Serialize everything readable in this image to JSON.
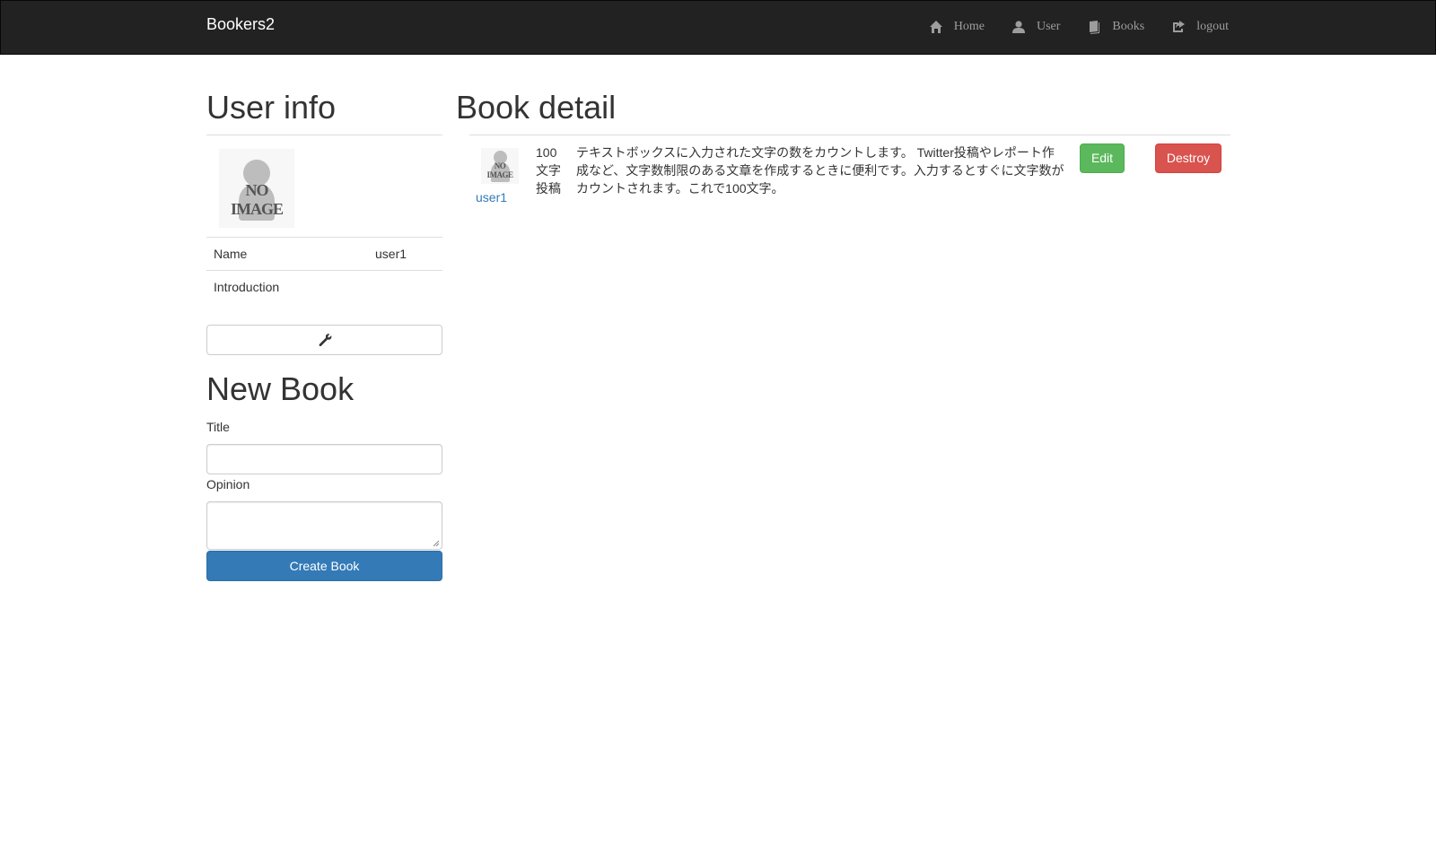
{
  "navbar": {
    "brand": "Bookers2",
    "items": [
      {
        "label": "Home",
        "icon": "home-icon"
      },
      {
        "label": "User",
        "icon": "user-icon"
      },
      {
        "label": "Books",
        "icon": "book-icon"
      },
      {
        "label": "logout",
        "icon": "logout-icon"
      }
    ]
  },
  "user_info": {
    "heading": "User info",
    "avatar_text": "NO IMAGE",
    "rows": [
      {
        "key": "Name",
        "value": "user1"
      },
      {
        "key": "Introduction",
        "value": ""
      }
    ],
    "edit_icon": "wrench-icon"
  },
  "new_book": {
    "heading": "New Book",
    "title_label": "Title",
    "title_value": "",
    "opinion_label": "Opinion",
    "opinion_value": "",
    "submit_label": "Create Book"
  },
  "book_detail": {
    "heading": "Book detail",
    "avatar_text": "NO IMAGE",
    "user_name": "user1",
    "title": "100文字投稿",
    "body": "テキストボックスに入力された文字の数をカウントします。 Twitter投稿やレポート作成など、文字数制限のある文章を作成するときに便利です。入力するとすぐに文字数がカウントされます。これで100文字。",
    "edit_label": "Edit",
    "destroy_label": "Destroy"
  },
  "colors": {
    "navbar_bg": "#222222",
    "nav_text": "#9d9d9d",
    "link": "#337ab7",
    "primary": "#337ab7",
    "success": "#5cb85c",
    "danger": "#d9534f"
  }
}
